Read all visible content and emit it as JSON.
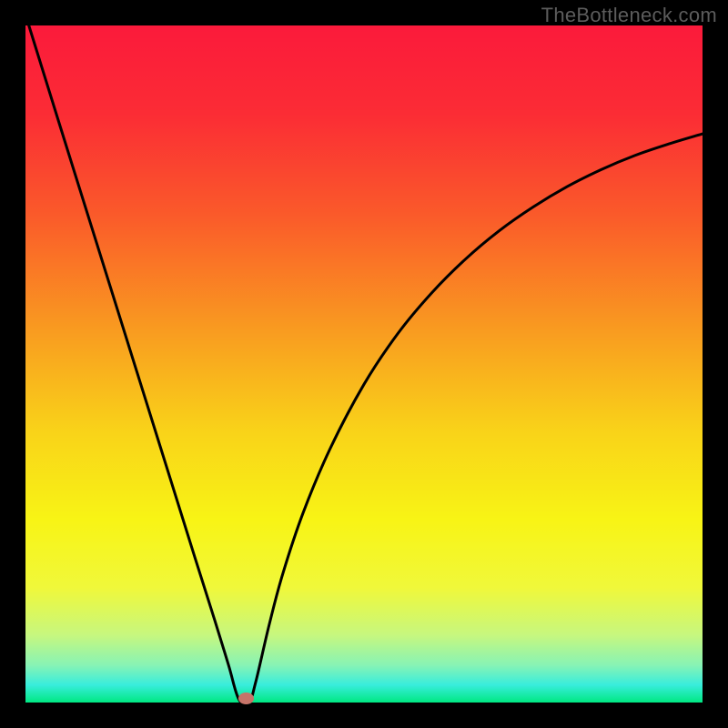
{
  "watermark": "TheBottleneck.com",
  "icons": {
    "marker": "marker-dot-icon"
  },
  "chart_data": {
    "type": "line",
    "title": "",
    "xlabel": "",
    "ylabel": "",
    "xlim": [
      0,
      100
    ],
    "ylim": [
      0,
      100
    ],
    "grid": false,
    "legend": false,
    "background_gradient_stops": [
      {
        "offset": 0.0,
        "color": "#fb1a3b"
      },
      {
        "offset": 0.13,
        "color": "#fb2c35"
      },
      {
        "offset": 0.28,
        "color": "#fa5a2a"
      },
      {
        "offset": 0.45,
        "color": "#f99b20"
      },
      {
        "offset": 0.6,
        "color": "#f9d319"
      },
      {
        "offset": 0.73,
        "color": "#f8f415"
      },
      {
        "offset": 0.83,
        "color": "#f0f83a"
      },
      {
        "offset": 0.9,
        "color": "#c7f77e"
      },
      {
        "offset": 0.945,
        "color": "#87f3b5"
      },
      {
        "offset": 0.974,
        "color": "#38eddc"
      },
      {
        "offset": 1.0,
        "color": "#00e882"
      }
    ],
    "series": [
      {
        "name": "curve",
        "type": "line",
        "color": "#000000",
        "x": [
          0.5,
          5,
          10,
          15,
          20,
          25,
          28,
          30,
          31.5,
          33,
          34,
          36,
          38,
          41,
          45,
          50,
          55,
          60,
          65,
          70,
          75,
          80,
          85,
          90,
          95,
          100
        ],
        "y": [
          100,
          85.5,
          69.5,
          53.5,
          37.5,
          21.5,
          12,
          5.5,
          0.5,
          0,
          3,
          11.5,
          19,
          28,
          37.5,
          47,
          54.5,
          60.5,
          65.5,
          69.7,
          73.2,
          76.2,
          78.7,
          80.8,
          82.5,
          84
        ]
      }
    ],
    "annotations": [
      {
        "type": "marker",
        "name": "min-point",
        "x": 32.6,
        "y": 0.6,
        "rx": 1.2,
        "ry": 0.9,
        "color": "#c77469"
      }
    ]
  }
}
